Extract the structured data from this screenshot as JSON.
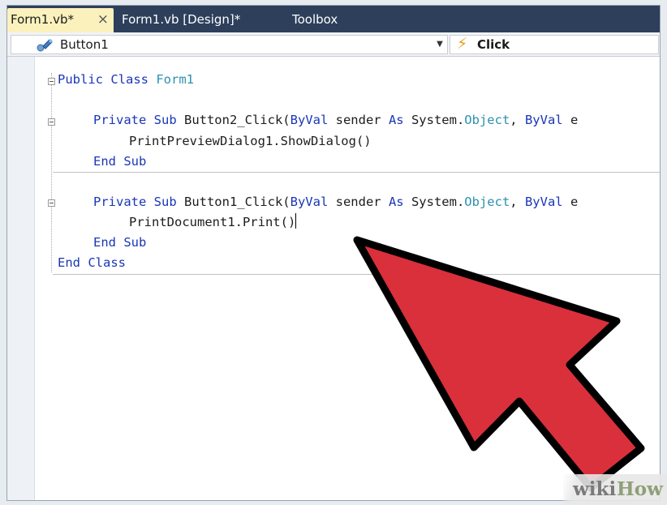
{
  "tabs": [
    {
      "label": "Form1.vb*",
      "active": true
    },
    {
      "label": "Form1.vb [Design]*",
      "active": false
    },
    {
      "label": "Toolbox",
      "active": false
    }
  ],
  "tab_close_glyph": "×",
  "nav": {
    "object_icon": "class-icon",
    "object_label": "Button1",
    "event_icon": "lightning-icon",
    "event_label": "Click"
  },
  "code": {
    "line1": {
      "kw": "Public Class ",
      "ty": "Form1"
    },
    "line2": {
      "kw1": "Private Sub ",
      "txt1": "Button2_Click(",
      "kw2": "ByVal",
      "txt2": " sender ",
      "kw3": "As",
      "txt3": " System.",
      "ty": "Object",
      "txt4": ", ",
      "kw4": "ByVal",
      "txt5": " e"
    },
    "line3": "PrintPreviewDialog1.ShowDialog()",
    "line4": "End Sub",
    "line5": {
      "kw1": "Private Sub ",
      "txt1": "Button1_Click(",
      "kw2": "ByVal",
      "txt2": " sender ",
      "kw3": "As",
      "txt3": " System.",
      "ty": "Object",
      "txt4": ", ",
      "kw4": "ByVal",
      "txt5": " e"
    },
    "line6": "PrintDocument1.Print()",
    "line7": "End Sub",
    "line8": "End Class"
  },
  "watermark": {
    "wiki": "wiki",
    "how": "How"
  },
  "colors": {
    "keyword": "#1a36b8",
    "type": "#2b91af",
    "tab_strip": "#2d3f5b",
    "active_tab": "#fbf1bd",
    "arrow_fill": "#d9303b",
    "arrow_outline": "#000000"
  }
}
